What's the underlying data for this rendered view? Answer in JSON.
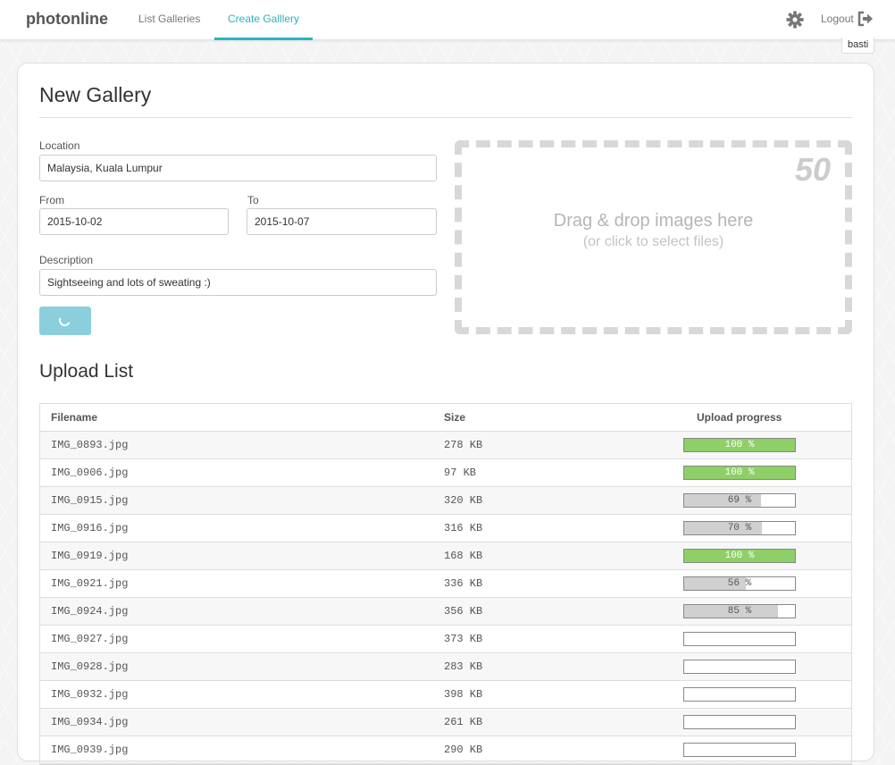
{
  "app": {
    "brand": "photonline"
  },
  "nav": {
    "items": [
      {
        "label": "List Galleries",
        "active": false
      },
      {
        "label": "Create Galllery",
        "active": true
      }
    ],
    "settings_icon": "gear-icon",
    "logout_label": "Logout",
    "logout_icon": "sign-out-icon",
    "username": "basti"
  },
  "colors": {
    "accent": "#2bb3c0",
    "progress_done": "#8ecf67",
    "progress_partial": "#d0d0d0",
    "submit_button": "#8ccfdc"
  },
  "form": {
    "title": "New Gallery",
    "location": {
      "label": "Location",
      "value": "Malaysia, Kuala Lumpur"
    },
    "from": {
      "label": "From",
      "value": "2015-10-02"
    },
    "to": {
      "label": "To",
      "value": "2015-10-07"
    },
    "description": {
      "label": "Description",
      "value": "Sightseeing and lots of sweating :)"
    },
    "submit_state": "loading"
  },
  "dropzone": {
    "count": "50",
    "main_text": "Drag & drop images here",
    "sub_text": "(or click to select files)"
  },
  "upload_list": {
    "title": "Upload List",
    "columns": [
      "Filename",
      "Size",
      "Upload progress"
    ],
    "rows": [
      {
        "filename": "IMG_0893.jpg",
        "size": "278 KB",
        "progress": 100,
        "progress_label": "100 %"
      },
      {
        "filename": "IMG_0906.jpg",
        "size": "97 KB",
        "progress": 100,
        "progress_label": "100 %"
      },
      {
        "filename": "IMG_0915.jpg",
        "size": "320 KB",
        "progress": 69,
        "progress_label": "69 %"
      },
      {
        "filename": "IMG_0916.jpg",
        "size": "316 KB",
        "progress": 70,
        "progress_label": "70 %"
      },
      {
        "filename": "IMG_0919.jpg",
        "size": "168 KB",
        "progress": 100,
        "progress_label": "100 %"
      },
      {
        "filename": "IMG_0921.jpg",
        "size": "336 KB",
        "progress": 56,
        "progress_label": "56 %"
      },
      {
        "filename": "IMG_0924.jpg",
        "size": "356 KB",
        "progress": 85,
        "progress_label": "85 %"
      },
      {
        "filename": "IMG_0927.jpg",
        "size": "373 KB",
        "progress": 0,
        "progress_label": ""
      },
      {
        "filename": "IMG_0928.jpg",
        "size": "283 KB",
        "progress": 0,
        "progress_label": ""
      },
      {
        "filename": "IMG_0932.jpg",
        "size": "398 KB",
        "progress": 0,
        "progress_label": ""
      },
      {
        "filename": "IMG_0934.jpg",
        "size": "261 KB",
        "progress": 0,
        "progress_label": ""
      },
      {
        "filename": "IMG_0939.jpg",
        "size": "290 KB",
        "progress": 0,
        "progress_label": ""
      }
    ]
  }
}
